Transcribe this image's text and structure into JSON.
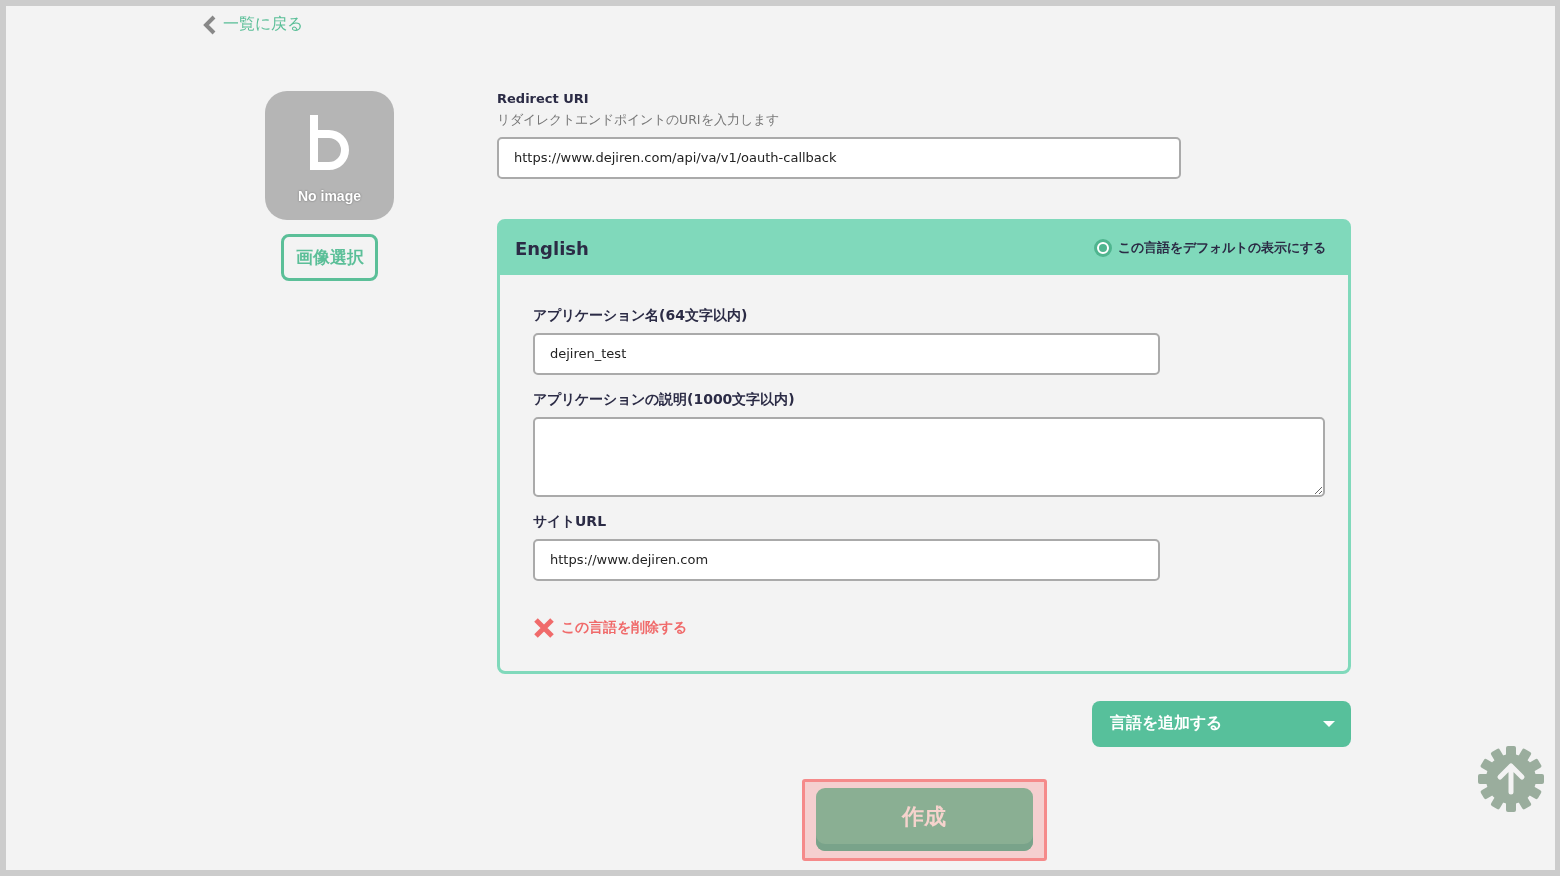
{
  "back_link": {
    "label": "一覧に戻る"
  },
  "image": {
    "caption": "No image",
    "button": "画像選択"
  },
  "redirect_uri": {
    "label": "Redirect URI",
    "hint": "リダイレクトエンドポイントのURIを入力します",
    "value": "https://www.dejiren.com/api/va/v1/oauth-callback"
  },
  "language_card": {
    "title": "English",
    "default_option": {
      "label": "この言語をデフォルトの表示にする",
      "selected": true
    },
    "fields": [
      {
        "kind": "input",
        "label": "アプリケーション名(64文字以内)",
        "value": "dejiren_test"
      },
      {
        "kind": "textarea",
        "label": "アプリケーションの説明(1000文字以内)"
      },
      {
        "kind": "input",
        "label": "サイトURL",
        "value": "https://www.dejiren.com"
      }
    ],
    "delete_link": "この言語を削除する"
  },
  "add_language_button": "言語を追加する",
  "create_button": "作成"
}
